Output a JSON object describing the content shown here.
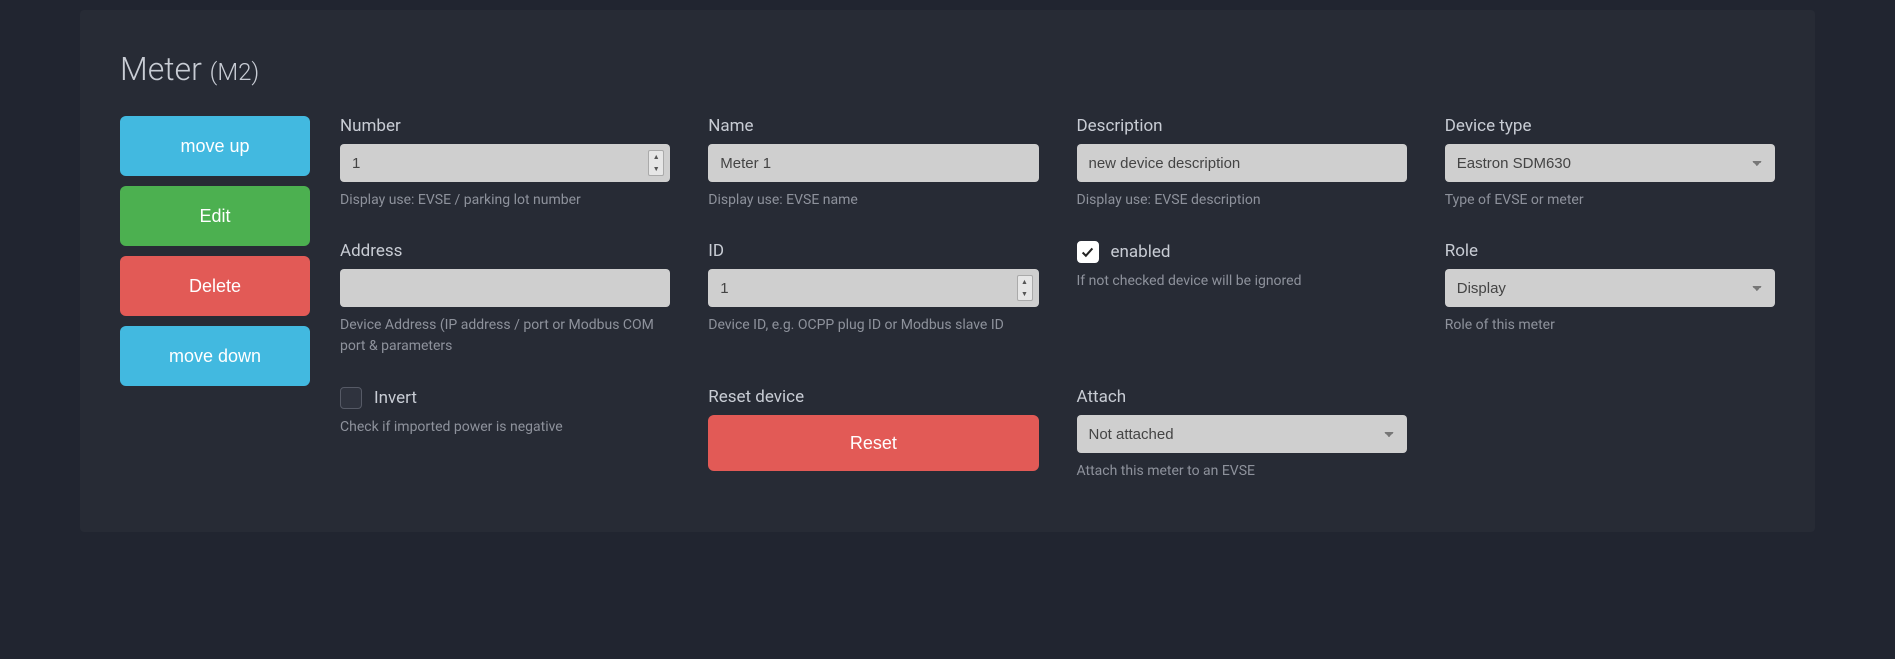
{
  "title": {
    "main": "Meter",
    "sub": "(M2)"
  },
  "side": {
    "move_up": "move up",
    "edit": "Edit",
    "delete": "Delete",
    "move_down": "move down"
  },
  "fields": {
    "number": {
      "label": "Number",
      "value": "1",
      "hint": "Display use: EVSE / parking lot number"
    },
    "name": {
      "label": "Name",
      "value": "Meter 1",
      "hint": "Display use: EVSE name"
    },
    "description": {
      "label": "Description",
      "value": "new device description",
      "hint": "Display use: EVSE description"
    },
    "device_type": {
      "label": "Device type",
      "value": "Eastron SDM630",
      "hint": "Type of EVSE or meter"
    },
    "address": {
      "label": "Address",
      "value": "",
      "hint": "Device Address (IP address / port or Modbus COM port & parameters"
    },
    "id": {
      "label": "ID",
      "value": "1",
      "hint": "Device ID, e.g. OCPP plug ID or Modbus slave ID"
    },
    "enabled": {
      "label": "enabled",
      "checked": true,
      "hint": "If not checked device will be ignored"
    },
    "role": {
      "label": "Role",
      "value": "Display",
      "hint": "Role of this meter"
    },
    "invert": {
      "label": "Invert",
      "checked": false,
      "hint": "Check if imported power is negative"
    },
    "reset_device": {
      "label": "Reset device",
      "button": "Reset"
    },
    "attach": {
      "label": "Attach",
      "value": "Not attached",
      "hint": "Attach this meter to an EVSE"
    }
  }
}
